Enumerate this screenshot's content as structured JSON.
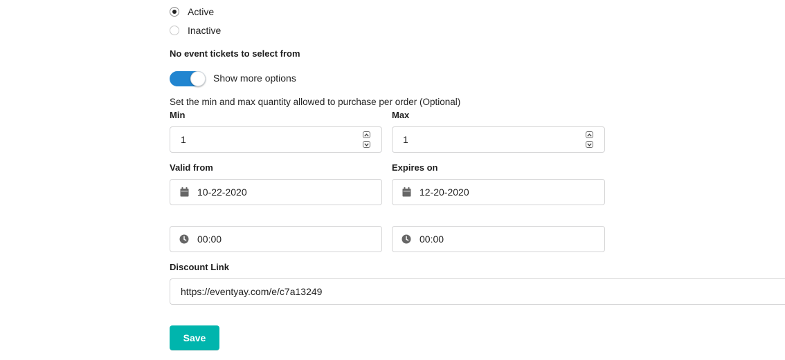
{
  "status": {
    "options": [
      {
        "label": "Active",
        "checked": true
      },
      {
        "label": "Inactive",
        "checked": false
      }
    ]
  },
  "tickets_notice": "No event tickets to select from",
  "more_options": {
    "label": "Show more options",
    "enabled": true
  },
  "quantity": {
    "description": "Set the min and max quantity allowed to purchase per order (Optional)",
    "min_label": "Min",
    "min_value": "1",
    "max_label": "Max",
    "max_value": "1"
  },
  "validity": {
    "valid_from_label": "Valid from",
    "valid_from_date": "10-22-2020",
    "valid_from_time": "00:00",
    "expires_on_label": "Expires on",
    "expires_on_date": "12-20-2020",
    "expires_on_time": "00:00"
  },
  "discount_link": {
    "label": "Discount Link",
    "value": "https://eventyay.com/e/c7a13249"
  },
  "save_label": "Save",
  "colors": {
    "primary": "#2185d0",
    "teal": "#00b5ad",
    "border": "#d4d4d5",
    "icon": "#666666"
  }
}
